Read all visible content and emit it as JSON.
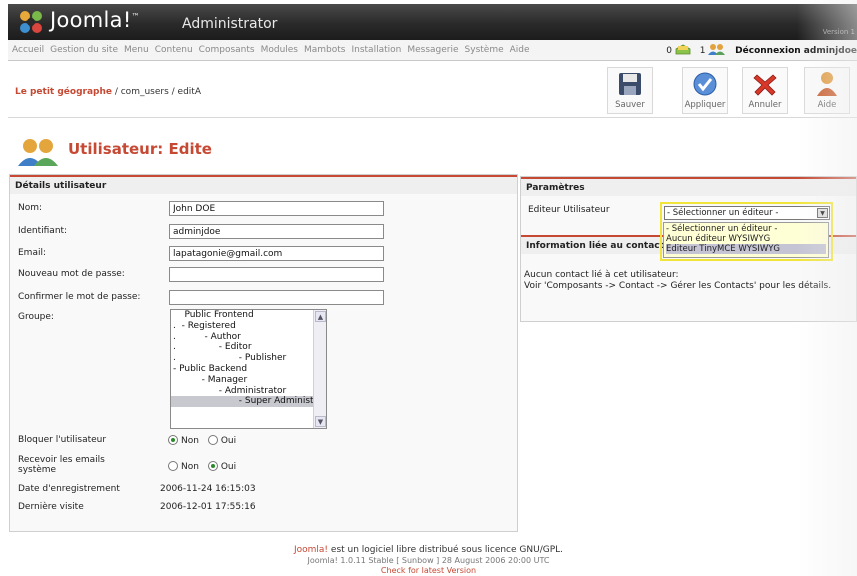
{
  "header": {
    "brand": "Joomla!",
    "admin_label": "Administrator",
    "version_label": "Version 1"
  },
  "menu": {
    "items": [
      "Accueil",
      "Gestion du site",
      "Menu",
      "Contenu",
      "Composants",
      "Modules",
      "Mambots",
      "Installation",
      "Messagerie",
      "Système",
      "Aide"
    ],
    "messages_count": "0",
    "users_count": "1",
    "logout_label": "Déconnexion adminjdoe"
  },
  "pathway": {
    "site": "Le petit géographe",
    "rest": " / com_users / editA"
  },
  "toolbar": {
    "save": "Sauver",
    "apply": "Appliquer",
    "cancel": "Annuler",
    "help": "Aide"
  },
  "page": {
    "title": "Utilisateur:",
    "subtitle": "Edite"
  },
  "details": {
    "heading": "Détails utilisateur",
    "name_label": "Nom:",
    "name_value": "John DOE",
    "username_label": "Identifiant:",
    "username_value": "adminjdoe",
    "email_label": "Email:",
    "email_value": "lapatagonie@gmail.com",
    "new_password_label": "Nouveau mot de passe:",
    "confirm_password_label": "Confirmer le mot de passe:",
    "group_label": "Groupe:",
    "groups": [
      {
        "text": "    Public Frontend",
        "selected": false
      },
      {
        "text": ".  - Registered",
        "selected": false
      },
      {
        "text": ".          - Author",
        "selected": false
      },
      {
        "text": ".               - Editor",
        "selected": false
      },
      {
        "text": ".                      - Publisher",
        "selected": false
      },
      {
        "text": "- Public Backend",
        "selected": false
      },
      {
        "text": "          - Manager",
        "selected": false
      },
      {
        "text": "                - Administrator",
        "selected": false
      },
      {
        "text": "                       - Super Administrator",
        "selected": true
      }
    ],
    "block_label": "Bloquer l'utilisateur",
    "block_no": "Non",
    "block_yes": "Oui",
    "emails_label_1": "Recevoir les emails",
    "emails_label_2": "système",
    "emails_no": "Non",
    "emails_yes": "Oui",
    "register_date_label": "Date d'enregistrement",
    "register_date_value": "2006-11-24 16:15:03",
    "last_visit_label": "Dernière visite",
    "last_visit_value": "2006-12-01 17:55:16"
  },
  "params": {
    "heading": "Paramètres",
    "editor_label": "Editeur Utilisateur",
    "editor_selected": "- Sélectionner un éditeur -",
    "editor_options": [
      "- Sélectionner un éditeur -",
      "Aucun éditeur WYSIWYG",
      "Editeur TinyMCE WYSIWYG"
    ],
    "contact_heading": "Information liée au contact",
    "contact_line1": "Aucun contact lié à cet utilisateur:",
    "contact_line2": "Voir 'Composants -> Contact -> Gérer les Contacts' pour les détails."
  },
  "footer": {
    "joomla": "Joomla!",
    "line1_rest": " est un logiciel libre distribué sous licence GNU/GPL.",
    "line2": "Joomla! 1.0.11 Stable [ Sunbow ] 28 August 2006 20:00 UTC",
    "line3": "Check for latest Version"
  },
  "colors": {
    "accent": "#c64934",
    "header_bg": "#2a2a2a",
    "highlight": "#f1e53a"
  }
}
